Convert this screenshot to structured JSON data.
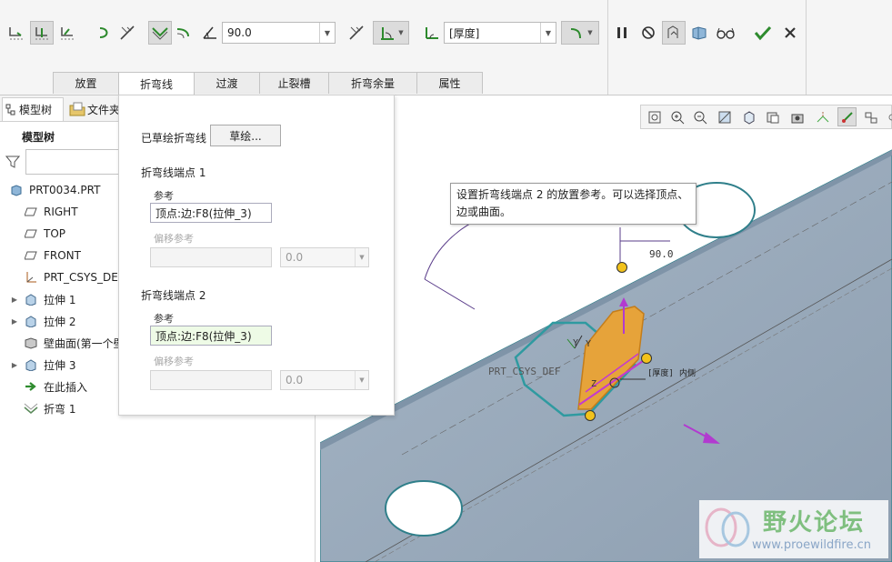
{
  "dashboard": {
    "angle_value": "90.0",
    "thickness_value": "[厚度]",
    "tabs": [
      {
        "label": "放置"
      },
      {
        "label": "折弯线"
      },
      {
        "label": "过渡"
      },
      {
        "label": "止裂槽"
      },
      {
        "label": "折弯余量"
      },
      {
        "label": "属性"
      }
    ],
    "selected_tab": "折弯线"
  },
  "left_panel": {
    "tabs": [
      {
        "label": "模型树",
        "icon": "model-tree-icon"
      },
      {
        "label": "文件夹",
        "icon": "folder-icon"
      }
    ],
    "header": "模型树",
    "tree": [
      {
        "label": "PRT0034.PRT",
        "icon": "part-icon",
        "expandable": false
      },
      {
        "label": "RIGHT",
        "icon": "datum-plane-icon",
        "expandable": false
      },
      {
        "label": "TOP",
        "icon": "datum-plane-icon",
        "expandable": false
      },
      {
        "label": "FRONT",
        "icon": "datum-plane-icon",
        "expandable": false
      },
      {
        "label": "PRT_CSYS_DEF",
        "icon": "csys-icon",
        "expandable": false
      },
      {
        "label": "拉伸 1",
        "icon": "extrude-icon",
        "expandable": true
      },
      {
        "label": "拉伸 2",
        "icon": "extrude-icon",
        "expandable": true
      },
      {
        "label": "壁曲面(第一个壁",
        "icon": "wall-icon",
        "expandable": false
      },
      {
        "label": "拉伸 3",
        "icon": "extrude-icon",
        "expandable": true
      },
      {
        "label": "在此插入",
        "icon": "insert-here-icon",
        "expandable": false
      },
      {
        "label": "折弯 1",
        "icon": "bend-icon",
        "expandable": false
      }
    ]
  },
  "bend_panel": {
    "sketched_label": "已草绘折弯线",
    "sketch_button": "草绘...",
    "endpoint1": {
      "title": "折弯线端点 1",
      "ref_label": "参考",
      "ref_value": "顶点:边:F8(拉伸_3)",
      "offset_label": "偏移参考",
      "offset_value": "0.0"
    },
    "endpoint2": {
      "title": "折弯线端点 2",
      "ref_label": "参考",
      "ref_value": "顶点:边:F8(拉伸_3)",
      "offset_label": "偏移参考",
      "offset_value": "0.0"
    }
  },
  "viewport": {
    "tooltip_line1": "设置折弯线端点 2 的放置参考。可以选择顶点、",
    "tooltip_line2": "边或曲面。",
    "dimension_label": "90.0",
    "csys_label": "PRT_CSYS_DEF",
    "axis_y": "Y",
    "axis_z": "Z",
    "thickness_tag": "[厚度]",
    "inner_tag": "内侧",
    "watermark_title": "野火论坛",
    "watermark_url": "www.proewildfire.cn"
  },
  "colors": {
    "plate": "#97a9bb",
    "highlight": "#e6a33a",
    "accent_magenta": "#b23ad0",
    "confirm_green": "#2e8b2e"
  }
}
